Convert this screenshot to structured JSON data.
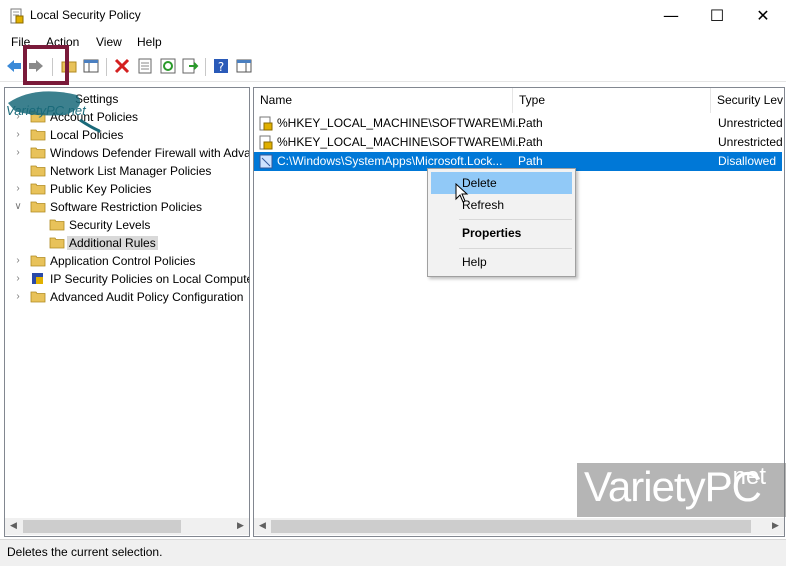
{
  "window": {
    "title": "Local Security Policy",
    "minimize": "—",
    "maximize": "☐",
    "close": "✕"
  },
  "menu": [
    "File",
    "Action",
    "View",
    "Help"
  ],
  "tree": {
    "root_label": "Settings",
    "items": [
      {
        "label": "Account Policies",
        "level": 1,
        "arrow": ">"
      },
      {
        "label": "Local Policies",
        "level": 1,
        "arrow": ">"
      },
      {
        "label": "Windows Defender Firewall with Adva",
        "level": 1,
        "arrow": ">"
      },
      {
        "label": "Network List Manager Policies",
        "level": 1,
        "arrow": ""
      },
      {
        "label": "Public Key Policies",
        "level": 1,
        "arrow": ">"
      },
      {
        "label": "Software Restriction Policies",
        "level": 1,
        "arrow": "v"
      },
      {
        "label": "Security Levels",
        "level": 2,
        "arrow": ""
      },
      {
        "label": "Additional Rules",
        "level": 2,
        "arrow": ""
      },
      {
        "label": "Application Control Policies",
        "level": 1,
        "arrow": ">"
      },
      {
        "label": "IP Security Policies on Local Compute",
        "level": 1,
        "arrow": ">"
      },
      {
        "label": "Advanced Audit Policy Configuration",
        "level": 1,
        "arrow": ">"
      }
    ]
  },
  "list": {
    "columns": [
      "Name",
      "Type",
      "Security Lev"
    ],
    "rows": [
      {
        "name": "%HKEY_LOCAL_MACHINE\\SOFTWARE\\Mi...",
        "type": "Path",
        "level": "Unrestricted"
      },
      {
        "name": "%HKEY_LOCAL_MACHINE\\SOFTWARE\\Mi...",
        "type": "Path",
        "level": "Unrestricted"
      },
      {
        "name": "C:\\Windows\\SystemApps\\Microsoft.Lock...",
        "type": "Path",
        "level": "Disallowed"
      }
    ]
  },
  "context_menu": {
    "delete": "Delete",
    "refresh": "Refresh",
    "properties": "Properties",
    "help": "Help"
  },
  "status": "Deletes the current selection.",
  "watermark": {
    "main": "VarietyPC",
    "suffix": ".net",
    "small": "VarietyPC.net"
  },
  "colors": {
    "selection": "#0078d7",
    "menu_hover": "#91c9f7",
    "folder": "#e8c25a"
  }
}
